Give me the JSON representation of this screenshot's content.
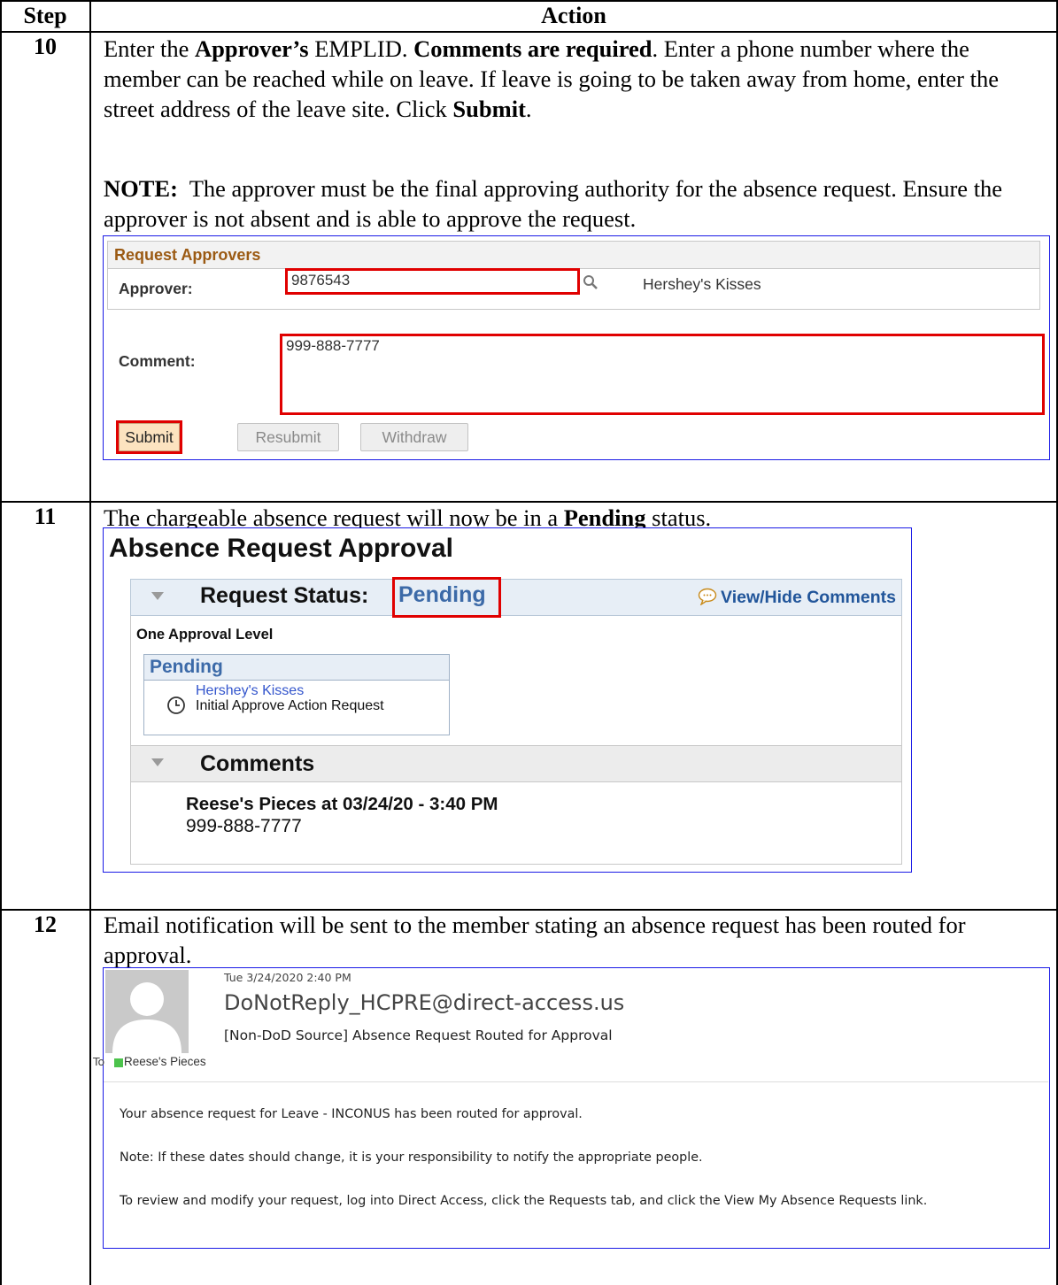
{
  "table": {
    "header_step": "Step",
    "header_action": "Action"
  },
  "steps": [
    {
      "number": "10",
      "text_html": "Enter the <b>Approver’s</b> EMPLID.  <b>Comments are required</b>.  Enter a phone number where the member can be reached while on leave.  If leave is going to be taken away from home, enter the street address of the leave site.  Click <b>Submit</b>.",
      "note_label": "NOTE:",
      "note_text": "The approver must be the final approving authority for the absence request.  Ensure the approver is not absent and is able to approve the request."
    },
    {
      "number": "11",
      "text_html": "The chargeable absence request will now be in a <b>Pending</b> status."
    },
    {
      "number": "12",
      "text_html": "Email notification will be sent to the member stating an absence request has been routed for approval."
    }
  ],
  "request_approvers": {
    "section_title": "Request Approvers",
    "approver_label": "Approver:",
    "approver_value": "9876543",
    "approver_name": "Hershey's Kisses",
    "comment_label": "Comment:",
    "comment_value": "999-888-7777",
    "submit_label": "Submit",
    "resubmit_label": "Resubmit",
    "withdraw_label": "Withdraw"
  },
  "absence_approval": {
    "title": "Absence Request Approval",
    "request_status_label": "Request Status:",
    "request_status_value": "Pending",
    "view_hide_comments": "View/Hide Comments",
    "approval_level": "One Approval Level",
    "card_status": "Pending",
    "card_approver": "Hershey's Kisses",
    "card_action": "Initial Approve Action Request",
    "comments_label": "Comments",
    "comment_author": "Reese's Pieces at 03/24/20 - 3:40 PM",
    "comment_text": "999-888-7777",
    "colors": {
      "status_blue": "#3c6aa8",
      "highlight_red": "#e00000"
    }
  },
  "email": {
    "date": "Tue 3/24/2020 2:40 PM",
    "from": "DoNotReply_HCPRE@direct-access.us",
    "subject": "[Non-DoD Source] Absence Request Routed for Approval",
    "to_label": "To",
    "to_name": "Reese's Pieces",
    "body": [
      "Your absence request for Leave - INCONUS has been routed for approval.",
      "Note: If these dates should change, it is your responsibility to notify the appropriate people.",
      "To review and modify your request, log into Direct Access, click the Requests tab, and click the View My Absence Requests link."
    ]
  }
}
